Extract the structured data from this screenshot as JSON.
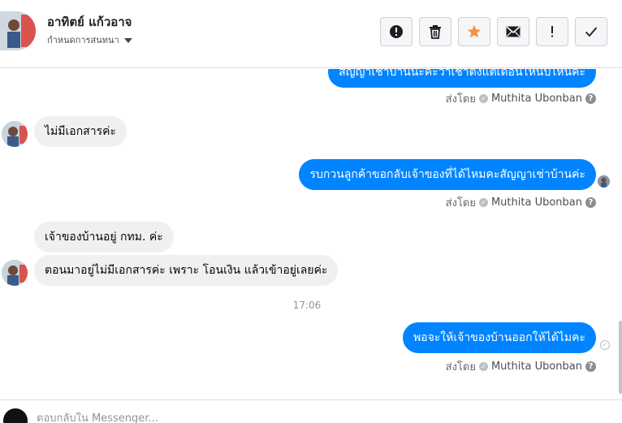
{
  "header": {
    "name": "อาทิตย์ แก้วอาจ",
    "subtitle": "กำหนดการสนทนา",
    "actions": [
      {
        "icon": "alert-circle-icon",
        "glyph": "!"
      },
      {
        "icon": "trash-icon"
      },
      {
        "icon": "star-icon",
        "color": "#f7923b"
      },
      {
        "icon": "envelope-icon"
      },
      {
        "icon": "exclamation-icon",
        "glyph": "!"
      },
      {
        "icon": "checkmark-icon"
      }
    ]
  },
  "messages": [
    {
      "direction": "out",
      "text": "สัญญาเช่าบ้านนะคะว่าเช่าตั้งแต่เดือนไหนปีไหนคะ"
    },
    {
      "direction": "in",
      "text": "ไม่มีเอกสารค่ะ"
    },
    {
      "direction": "out",
      "text": "รบกวนลูกค้าขอกลับเจ้าของที่ได้ไหมคะสัญญาเช่าบ้านค่ะ"
    },
    {
      "direction": "in",
      "text": "เจ้าของบ้านอยู่ กทม. ค่ะ"
    },
    {
      "direction": "in",
      "text": "ตอนมาอยู่ไม่มีเอกสารค่ะ เพราะ โอนเงิน แล้วเข้าอยู่เลยค่ะ"
    },
    {
      "direction": "out",
      "text": "พอจะให้เจ้าของบ้านออกให้ได้ไมคะ"
    }
  ],
  "sent_by": {
    "prefix": "ส่งโดย",
    "sender": "Muthita Ubonban",
    "help_glyph": "?"
  },
  "timestamp": "17:06",
  "composer": {
    "placeholder": "ตอบกลับใน Messenger..."
  },
  "colors": {
    "outgoing_bubble": "#0084ff",
    "incoming_bubble": "#f0f0f0",
    "star": "#f7923b"
  }
}
